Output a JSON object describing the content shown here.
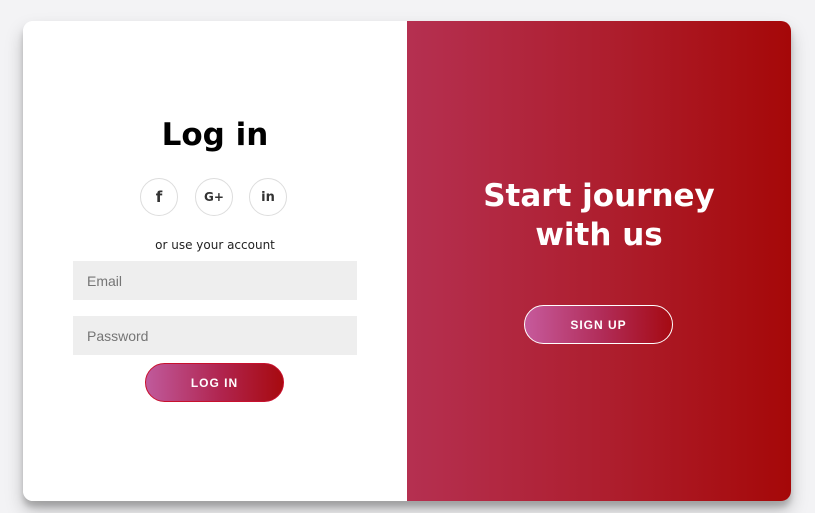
{
  "login_panel": {
    "title": "Log in",
    "social": [
      {
        "icon": "facebook-icon",
        "glyph": "f"
      },
      {
        "icon": "google-plus-icon",
        "glyph": "G+"
      },
      {
        "icon": "linkedin-icon",
        "glyph": "in"
      }
    ],
    "alt_text": "or use your account",
    "email_placeholder": "Email",
    "password_placeholder": "Password",
    "login_button": "LOG IN"
  },
  "signup_panel": {
    "heading_line1": "Start journey",
    "heading_line2": "with us",
    "signup_button": "SIGN UP"
  },
  "colors": {
    "accent_start": "#c05a9c",
    "accent_end": "#a50808",
    "panel_gradient_start": "#b53051",
    "panel_gradient_end": "#a50808"
  }
}
